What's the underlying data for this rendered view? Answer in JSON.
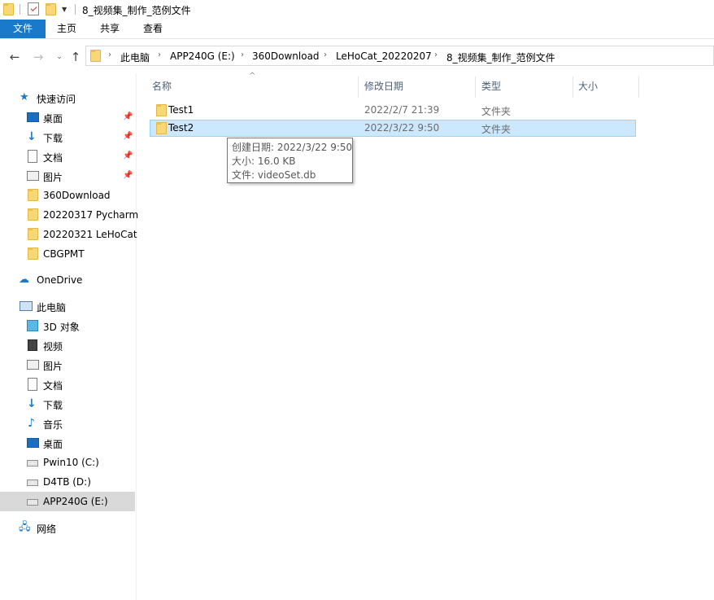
{
  "title_bar": {
    "title": "8_视频集_制作_范例文件"
  },
  "ribbon": {
    "tabs": [
      "文件",
      "主页",
      "共享",
      "查看"
    ]
  },
  "address_bar": {
    "crumbs": [
      "此电脑",
      "APP240G (E:)",
      "360Download",
      "LeHoCat_20220207",
      "8_视频集_制作_范例文件"
    ]
  },
  "nav_pane": {
    "quick_access": "快速访问",
    "quick_items": [
      {
        "label": "桌面",
        "icon": "desktop-icon",
        "pinned": true
      },
      {
        "label": "下载",
        "icon": "download-icon",
        "pinned": true
      },
      {
        "label": "文档",
        "icon": "documents-icon",
        "pinned": true
      },
      {
        "label": "图片",
        "icon": "pictures-icon",
        "pinned": true
      },
      {
        "label": "360Download",
        "icon": "folder-icon",
        "pinned": false
      },
      {
        "label": "20220317 Pycharm",
        "icon": "folder-icon",
        "pinned": false
      },
      {
        "label": "20220321 LeHoCat",
        "icon": "folder-icon",
        "pinned": false
      },
      {
        "label": "CBGPMT",
        "icon": "folder-icon",
        "pinned": false
      }
    ],
    "onedrive": "OneDrive",
    "this_pc": "此电脑",
    "pc_items": [
      {
        "label": "3D 对象",
        "icon": "3d-objects-icon"
      },
      {
        "label": "视频",
        "icon": "videos-icon"
      },
      {
        "label": "图片",
        "icon": "pictures-icon"
      },
      {
        "label": "文档",
        "icon": "documents-icon"
      },
      {
        "label": "下载",
        "icon": "download-icon"
      },
      {
        "label": "音乐",
        "icon": "music-icon"
      },
      {
        "label": "桌面",
        "icon": "desktop-icon"
      },
      {
        "label": "Pwin10 (C:)",
        "icon": "drive-icon"
      },
      {
        "label": "D4TB (D:)",
        "icon": "drive-icon"
      },
      {
        "label": "APP240G (E:)",
        "icon": "drive-icon",
        "selected": true
      }
    ],
    "network": "网络"
  },
  "columns": {
    "name": "名称",
    "modified": "修改日期",
    "type": "类型",
    "size": "大小"
  },
  "files": [
    {
      "name": "Test1",
      "modified": "2022/2/7 21:39",
      "type": "文件夹",
      "selected": false
    },
    {
      "name": "Test2",
      "modified": "2022/3/22 9:50",
      "type": "文件夹",
      "selected": true
    }
  ],
  "tooltip": {
    "line1": "创建日期: 2022/3/22 9:50",
    "line2": "大小: 16.0 KB",
    "line3": "文件: videoSet.db"
  },
  "colors": {
    "accent": "#1979ca",
    "selection": "#cce8ff",
    "folder": "#f8d775"
  }
}
